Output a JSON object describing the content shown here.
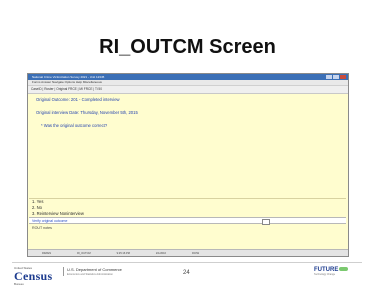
{
  "slide": {
    "title": "RI_OUTCM Screen",
    "page_number": "24"
  },
  "window": {
    "title": "National Crime Victimization Survey 2021 - Unit 12345",
    "menu": "Forms   Answer   Navigate   Options   Help   Miscellaneous",
    "tabs": "CaseID | Roster | Original FRCE | MI FRCE | Ti 50"
  },
  "content": {
    "line1": "Original Outcome: 201 - Completed interview",
    "line2": "Original interview Date: Thursday, November 5th, 2015",
    "question": "* Was the original outcome correct?"
  },
  "answers": [
    {
      "label": "1. Yes"
    },
    {
      "label": "2. No"
    },
    {
      "label": "3. Reinterview Noninterview"
    }
  ],
  "field": {
    "label": "Verify original outcome"
  },
  "rout_label": "ROUT notes",
  "status": [
    "RIMAIN",
    "RI_OUTCM",
    "9:25:16 PM",
    "2/1/2016",
    "RO/W"
  ],
  "footer": {
    "census_small": "United States",
    "census_big": "Census",
    "census_sub": "Bureau",
    "dept": "U.S. Department of Commerce",
    "dept_sub": "Economics and Statistics Administration",
    "future": "FUTURE",
    "future_sub": "Technology Change"
  }
}
